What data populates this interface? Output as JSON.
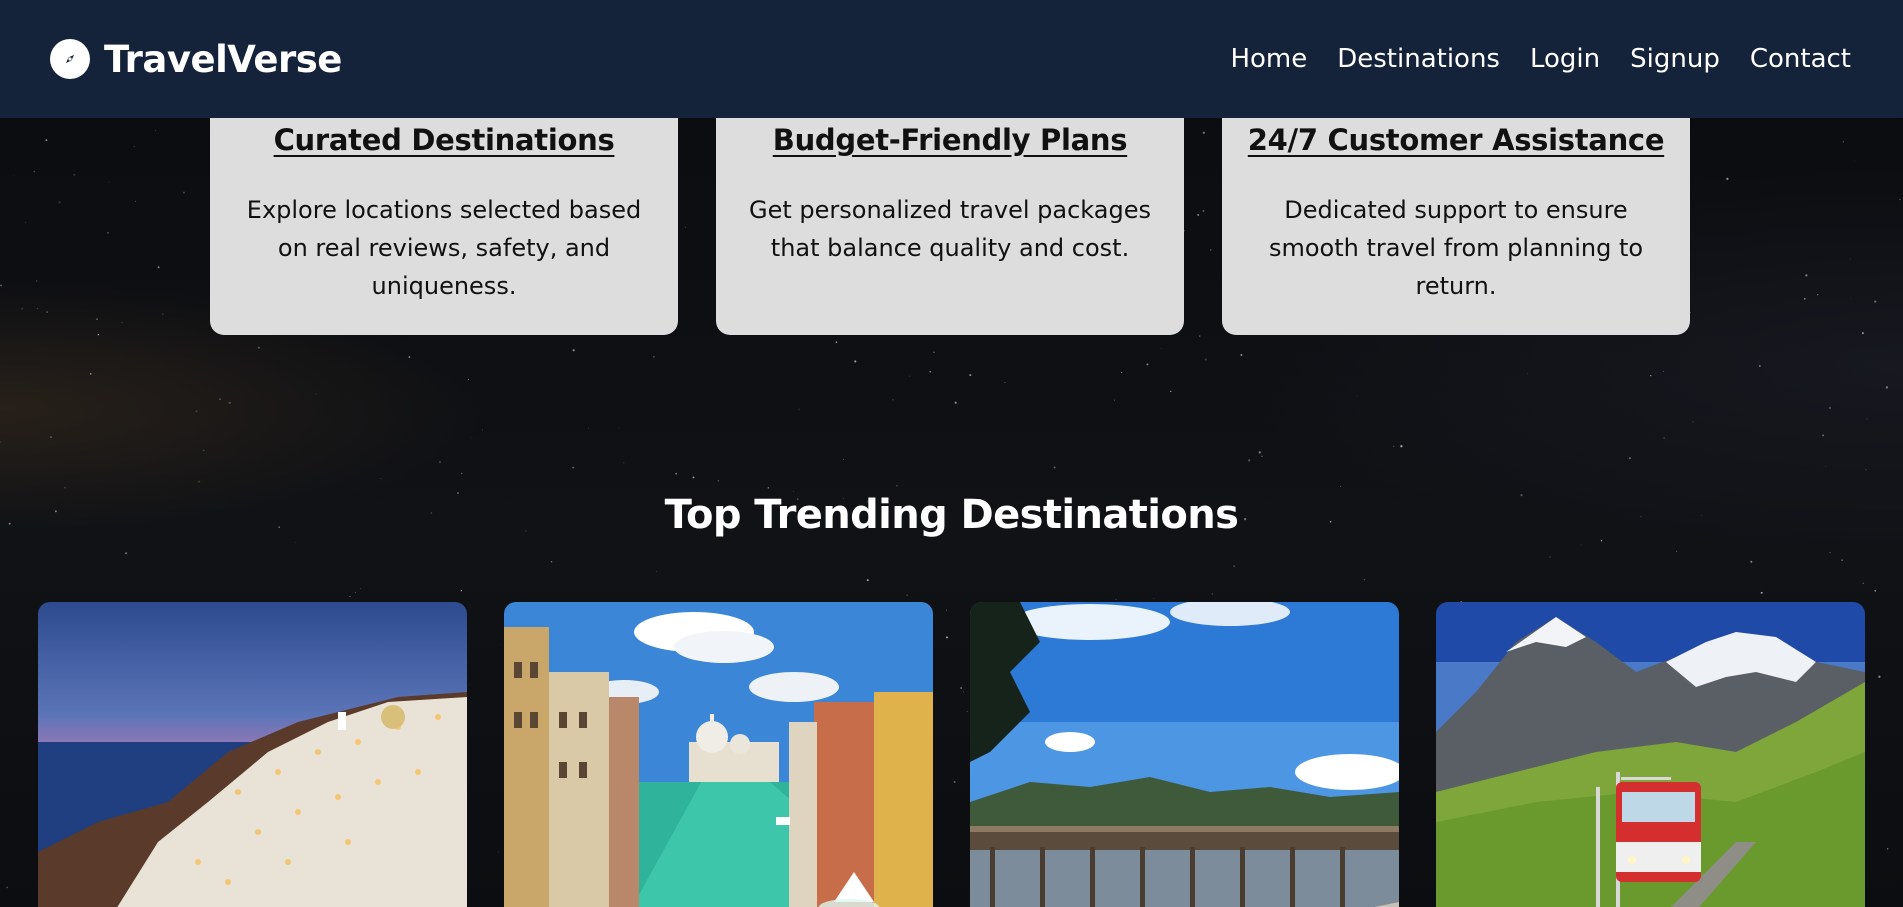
{
  "brand": {
    "name": "TravelVerse",
    "icon": "compass-icon"
  },
  "nav": {
    "links": [
      "Home",
      "Destinations",
      "Login",
      "Signup",
      "Contact"
    ]
  },
  "features": [
    {
      "title": "Curated Destinations",
      "description": "Explore locations selected based on real reviews, safety, and uniqueness."
    },
    {
      "title": "Budget-Friendly Plans",
      "description": "Get personalized travel packages that balance quality and cost."
    },
    {
      "title": "24/7 Customer Assistance",
      "description": "Dedicated support to ensure smooth travel from planning to return."
    }
  ],
  "trending": {
    "heading": "Top Trending Destinations"
  },
  "colors": {
    "navbar": "#14233a",
    "card": "#dddddd",
    "page_background": "#0b0d10"
  }
}
